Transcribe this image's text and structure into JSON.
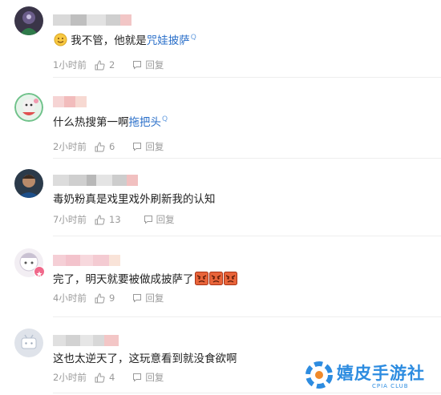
{
  "comments": [
    {
      "text_parts": [
        "我不管，他就是",
        "咒娃披萨",
        "Q"
      ],
      "time": "1小时前",
      "likes": "2",
      "reply_label": "回复"
    },
    {
      "text_parts": [
        "什么热搜第一啊",
        "拖把头",
        "Q"
      ],
      "time": "2小时前",
      "likes": "6",
      "reply_label": "回复"
    },
    {
      "text": "毒奶粉真是戏里戏外刷新我的认知",
      "time": "7小时前",
      "likes": "13",
      "reply_label": "回复"
    },
    {
      "text": "完了，明天就要被做成披萨了",
      "time": "4小时前",
      "likes": "9",
      "reply_label": "回复"
    },
    {
      "text": "这也太逆天了，这玩意看到就没食欲啊",
      "time": "2小时前",
      "likes": "4",
      "reply_label": "回复"
    }
  ],
  "watermark": {
    "title": "嬉皮手游社",
    "subtitle": "CPIA CLUB",
    "color": "#2d8ce0"
  },
  "colors": {
    "link": "#2a6fc9",
    "meta": "#9a9a9a",
    "name_blur_pink": "#f6c9c9",
    "name_blur_gray": "#d6d6d6"
  },
  "icons": [
    "smile-emoji-icon",
    "thumb-up-icon",
    "reply-icon",
    "angry-emoji-icon",
    "search-tag-icon"
  ]
}
